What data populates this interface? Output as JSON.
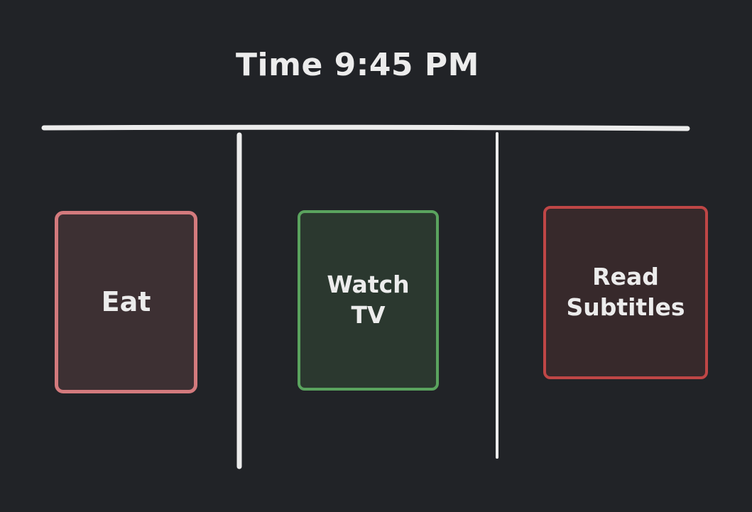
{
  "header": {
    "title": "Time 9:45 PM"
  },
  "cards": [
    {
      "label": "Eat",
      "border_color": "#d37a7d",
      "fill_color": "#3d3033"
    },
    {
      "label": "Watch TV",
      "border_color": "#5aa35e",
      "fill_color": "#2b382f"
    },
    {
      "label": "Read Subtitles",
      "border_color": "#bf4646",
      "fill_color": "#37292b"
    }
  ],
  "colors": {
    "background": "#212327",
    "lines": "#ececec",
    "text": "#ececec"
  }
}
